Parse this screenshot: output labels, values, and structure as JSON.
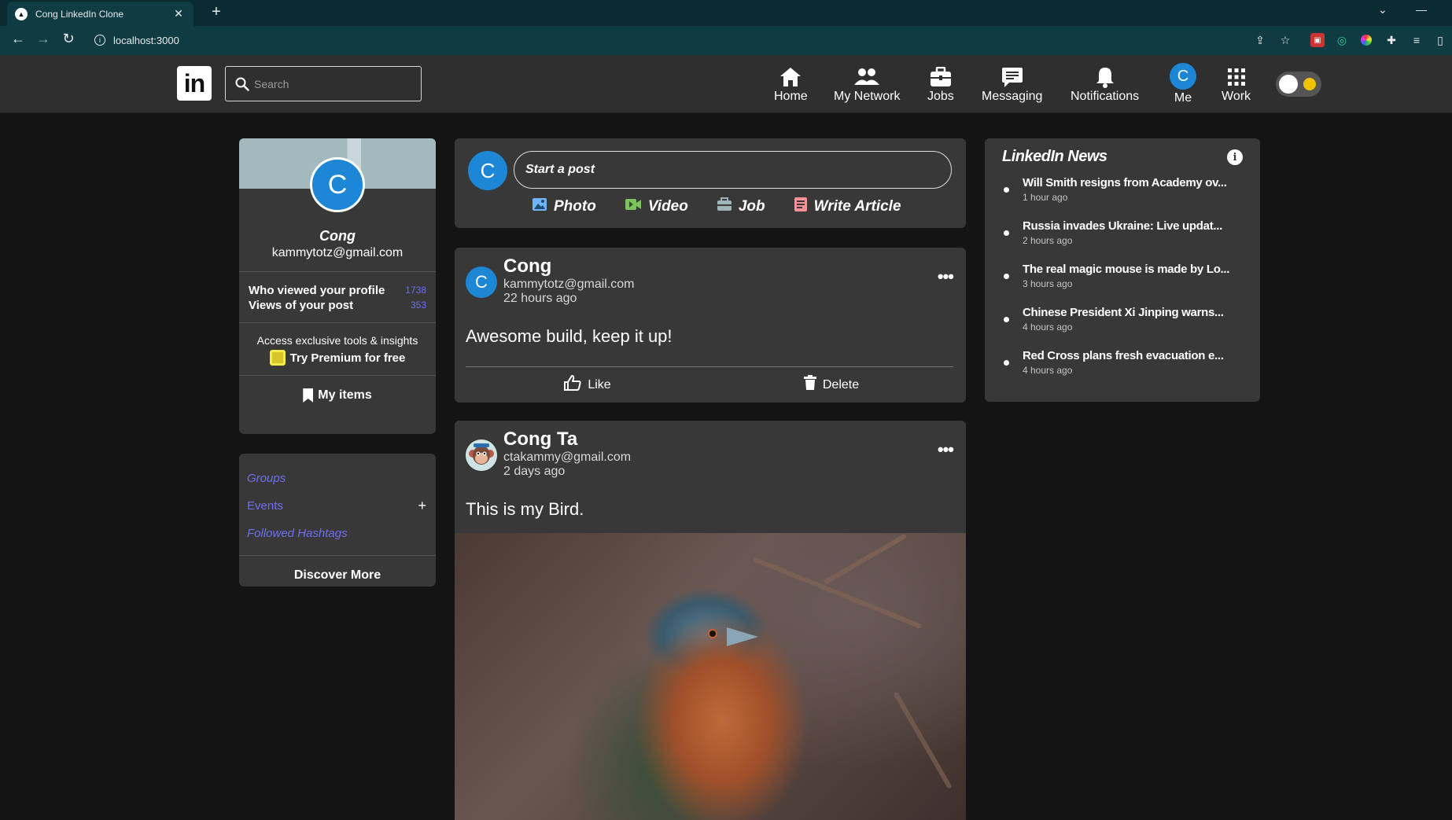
{
  "browser": {
    "tab_title": "Cong LinkedIn Clone",
    "tab_close": "✕",
    "new_tab": "+",
    "url": "localhost:3000"
  },
  "header": {
    "logo_text": "in",
    "search_placeholder": "Search",
    "nav": [
      {
        "label": "Home",
        "icon": "home-icon"
      },
      {
        "label": "My Network",
        "icon": "network-icon"
      },
      {
        "label": "Jobs",
        "icon": "briefcase-icon"
      },
      {
        "label": "Messaging",
        "icon": "message-icon"
      },
      {
        "label": "Notifications",
        "icon": "bell-icon"
      },
      {
        "label": "Me",
        "icon": "avatar",
        "avatar_letter": "C"
      },
      {
        "label": "Work",
        "icon": "grid-icon"
      }
    ]
  },
  "profile": {
    "avatar_letter": "C",
    "name": "Cong",
    "email": "kammytotz@gmail.com",
    "stats": [
      {
        "label": "Who viewed your profile",
        "value": "1738"
      },
      {
        "label": "Views of your post",
        "value": "353"
      }
    ],
    "premium_sub": "Access exclusive tools & insights",
    "premium_cta": "Try Premium for free",
    "my_items": "My items"
  },
  "groups": {
    "items": [
      {
        "label": "Groups"
      },
      {
        "label": "Events",
        "action": "+"
      },
      {
        "label": "Followed Hashtags"
      }
    ],
    "discover": "Discover More"
  },
  "composer": {
    "avatar_letter": "C",
    "placeholder": "Start a post",
    "actions": [
      {
        "label": "Photo",
        "icon": "photo-icon",
        "color": "#70b5f9"
      },
      {
        "label": "Video",
        "icon": "video-icon",
        "color": "#7fc15e"
      },
      {
        "label": "Job",
        "icon": "job-icon",
        "color": "#a0b4b7"
      },
      {
        "label": "Write Article",
        "icon": "article-icon",
        "color": "#fc9295"
      }
    ]
  },
  "posts": [
    {
      "avatar_letter": "C",
      "author": "Cong",
      "email": "kammytotz@gmail.com",
      "time": "22 hours ago",
      "more": "•••",
      "text": "Awesome build, keep it up!",
      "like": "Like",
      "delete": "Delete"
    },
    {
      "author": "Cong Ta",
      "email": "ctakammy@gmail.com",
      "time": "2 days ago",
      "more": "•••",
      "text": "This is my Bird."
    }
  ],
  "news": {
    "title": "LinkedIn News",
    "info": "i",
    "items": [
      {
        "headline": "Will Smith resigns from Academy ov...",
        "time": "1 hour ago"
      },
      {
        "headline": "Russia invades Ukraine: Live updat...",
        "time": "2 hours ago"
      },
      {
        "headline": "The real magic mouse is made by Lo...",
        "time": "3 hours ago"
      },
      {
        "headline": "Chinese President Xi Jinping warns...",
        "time": "4 hours ago"
      },
      {
        "headline": "Red Cross plans fresh evacuation e...",
        "time": "4 hours ago"
      }
    ]
  },
  "colors": {
    "accent": "#1d87d6",
    "link": "#6f6ff0",
    "card": "#383838",
    "page": "#141414"
  }
}
